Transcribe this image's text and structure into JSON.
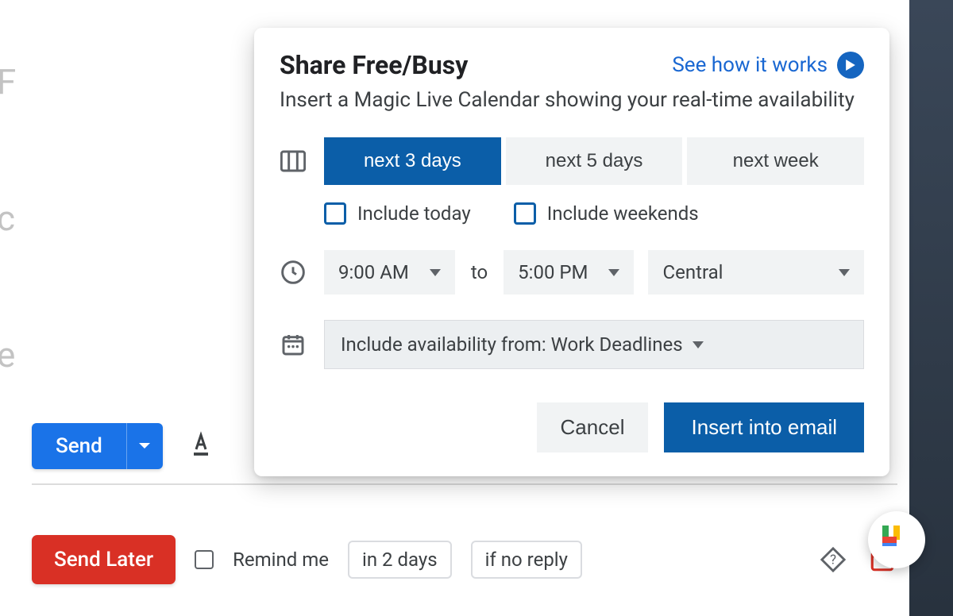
{
  "popover": {
    "title": "Share Free/Busy",
    "link_label": "See how it works",
    "subtitle": "Insert a Magic Live Calendar showing your real-time availability",
    "ranges": [
      "next 3 days",
      "next 5 days",
      "next week"
    ],
    "active_range_index": 0,
    "include_today_label": "Include today",
    "include_weekends_label": "Include weekends",
    "time_start": "9:00 AM",
    "time_to": "to",
    "time_end": "5:00 PM",
    "timezone": "Central",
    "availability_label": "Include availability from: Work Deadlines",
    "cancel_label": "Cancel",
    "insert_label": "Insert into email"
  },
  "compose": {
    "send_label": "Send",
    "send_later_label": "Send Later",
    "remind_label": "Remind me",
    "chip_delay": "in 2 days",
    "chip_condition": "if no reply"
  }
}
